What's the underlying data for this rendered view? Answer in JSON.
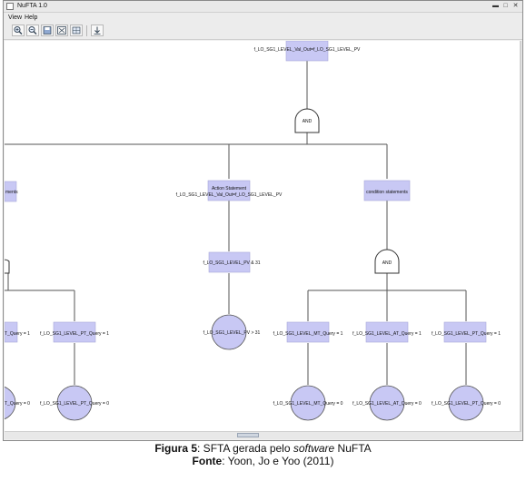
{
  "window": {
    "title": "NuFTA 1.0"
  },
  "menu": {
    "items": [
      "View",
      "Help"
    ]
  },
  "toolbar": {
    "icons": [
      "zoom-in-icon",
      "zoom-out-icon",
      "save-icon",
      "fit-icon",
      "grid-icon",
      "export-icon"
    ]
  },
  "tree": {
    "top_event": "f_LO_SG1_LEVEL_Val_Out=f_LO_SG1_LEVEL_PV",
    "gate_top": "AND",
    "action_statement_title": "Action Statement",
    "action_statement_expr": "f_LO_SG1_LEVEL_Val_Out=f_LO_SG1_LEVEL_PV",
    "left_partial_box": "ments",
    "condition_statements": "condition statements",
    "pv_box": "f_LO_SG1_LEVEL_PV & 31",
    "pv_basic": "f_LO_SG1_LEVEL_PV > 31",
    "gate_right": "AND",
    "left_box_1": "T_Query = 1",
    "left_box_2": "f_LO_SG1_LEVEL_PT_Query = 1",
    "left_circle_1": "T_Query = 0",
    "left_circle_2": "f_LO_SG1_LEVEL_PT_Query = 0",
    "right_box_mt": "f_LO_SG1_LEVEL_MT_Query = 1",
    "right_box_at": "f_LO_SG1_LEVEL_AT_Query = 1",
    "right_box_pt": "f_LO_SG1_LEVEL_PT_Query = 1",
    "right_circle_mt": "f_LO_SG1_LEVEL_MT_Query = 0",
    "right_circle_at": "f_LO_SG1_LEVEL_AT_Query = 0",
    "right_circle_pt": "f_LO_SG1_LEVEL_PT_Query = 0"
  },
  "colors": {
    "node_fill": "#c8c8f4",
    "node_stroke": "#a8a8d8",
    "line": "#555555"
  },
  "caption": {
    "fig_label": "Figura 5",
    "fig_text_1": ": SFTA  gerada pelo ",
    "fig_software": "software",
    "fig_text_2": " NuFTA",
    "source_label": "Fonte",
    "source_text": ": Yoon, Jo e Yoo (2011)"
  }
}
